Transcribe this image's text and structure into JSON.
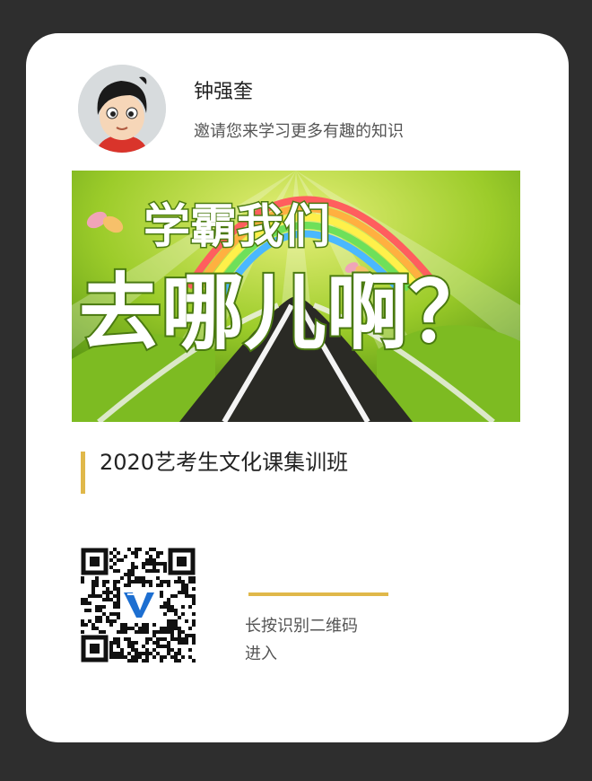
{
  "card": {
    "user_name": "钟强奎",
    "invite_text": "邀请您来学习更多有趣的知识",
    "banner_text": {
      "line1": "学霸我们",
      "line2": "去哪儿啊？"
    },
    "course_title": "2020艺考生文化课集训班",
    "qr_hint_line1": "长按识别二维码",
    "qr_hint_line2": "进入"
  },
  "colors": {
    "background": "#2e2e2e",
    "card": "#ffffff",
    "accent": "#e0b84a",
    "logo_blue": "#1d6fd1"
  },
  "icons": {
    "avatar": "cartoon-boy-avatar",
    "qr_code": "qr-code-icon",
    "qr_logo": "v-logo-icon"
  }
}
